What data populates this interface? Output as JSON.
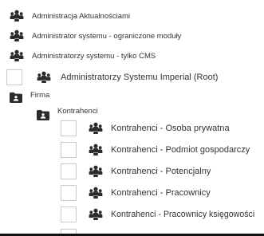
{
  "tree": {
    "top_items": [
      {
        "label": "Administracja Aktualnościami"
      },
      {
        "label": "Administrator systemu - ograniczone moduły"
      },
      {
        "label": "Administratorzy systemu - tylko CMS"
      },
      {
        "label": "Administratorzy Systemu Imperial (Root)"
      }
    ],
    "firma": {
      "label": "Firma"
    },
    "kontrahenci": {
      "label": "Kontrahenci"
    },
    "kontrahenci_items": [
      {
        "label": "Kontrahenci - Osoba prywatna"
      },
      {
        "label": "Kontrahenci - Podmiot gospodarczy"
      },
      {
        "label": "Kontrahenci - Potencjalny"
      },
      {
        "label": "Kontrahenci - Pracownicy"
      },
      {
        "label": "Kontrahenci - Pracownicy księgowości"
      }
    ]
  },
  "icons": {
    "group": "users-group-icon",
    "folder": "user-folder-icon"
  },
  "colors": {
    "icon": "#2b2b2b",
    "text": "#333333",
    "checkbox_border": "#c9c9c9"
  }
}
